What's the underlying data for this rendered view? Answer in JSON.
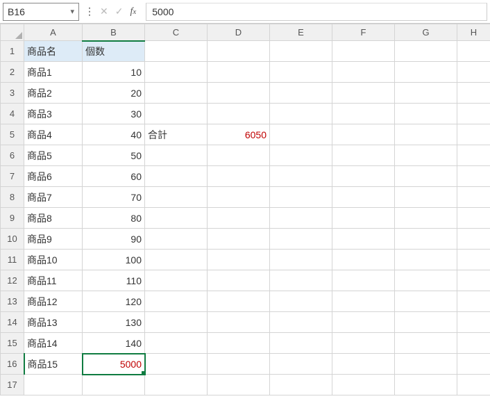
{
  "nameBox": "B16",
  "formulaBar": {
    "value": "5000"
  },
  "columns": [
    "A",
    "B",
    "C",
    "D",
    "E",
    "F",
    "G",
    "H"
  ],
  "rowCount": 17,
  "activeCell": {
    "row": 16,
    "col": "B"
  },
  "headerFill": {
    "row": 1,
    "cols": [
      "A",
      "B"
    ]
  },
  "cells": {
    "A1": {
      "v": "商品名",
      "t": "txt"
    },
    "B1": {
      "v": "個数",
      "t": "txt"
    },
    "A2": {
      "v": "商品1",
      "t": "txt"
    },
    "B2": {
      "v": "10",
      "t": "num"
    },
    "A3": {
      "v": "商品2",
      "t": "txt"
    },
    "B3": {
      "v": "20",
      "t": "num"
    },
    "A4": {
      "v": "商品3",
      "t": "txt"
    },
    "B4": {
      "v": "30",
      "t": "num"
    },
    "A5": {
      "v": "商品4",
      "t": "txt"
    },
    "B5": {
      "v": "40",
      "t": "num"
    },
    "C5": {
      "v": "合計",
      "t": "txt"
    },
    "D5": {
      "v": "6050",
      "t": "num",
      "red": true
    },
    "A6": {
      "v": "商品5",
      "t": "txt"
    },
    "B6": {
      "v": "50",
      "t": "num"
    },
    "A7": {
      "v": "商品6",
      "t": "txt"
    },
    "B7": {
      "v": "60",
      "t": "num"
    },
    "A8": {
      "v": "商品7",
      "t": "txt"
    },
    "B8": {
      "v": "70",
      "t": "num"
    },
    "A9": {
      "v": "商品8",
      "t": "txt"
    },
    "B9": {
      "v": "80",
      "t": "num"
    },
    "A10": {
      "v": "商品9",
      "t": "txt"
    },
    "B10": {
      "v": "90",
      "t": "num"
    },
    "A11": {
      "v": "商品10",
      "t": "txt"
    },
    "B11": {
      "v": "100",
      "t": "num"
    },
    "A12": {
      "v": "商品11",
      "t": "txt"
    },
    "B12": {
      "v": "110",
      "t": "num"
    },
    "A13": {
      "v": "商品12",
      "t": "txt"
    },
    "B13": {
      "v": "120",
      "t": "num"
    },
    "A14": {
      "v": "商品13",
      "t": "txt"
    },
    "B14": {
      "v": "130",
      "t": "num"
    },
    "A15": {
      "v": "商品14",
      "t": "txt"
    },
    "B15": {
      "v": "140",
      "t": "num"
    },
    "A16": {
      "v": "商品15",
      "t": "txt"
    },
    "B16": {
      "v": "5000",
      "t": "num",
      "red": true
    }
  }
}
